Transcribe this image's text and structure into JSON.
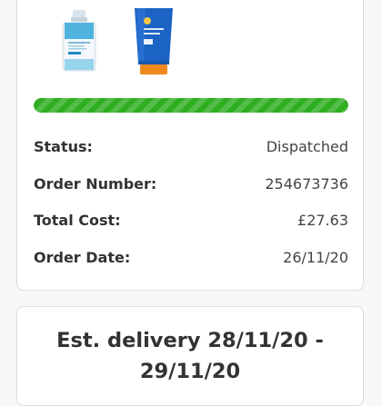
{
  "order": {
    "progress": 1.0,
    "progress_color": "#2fae21",
    "products": [
      {
        "name": "micellar-cleanser-bottle"
      },
      {
        "name": "sunscreen-tube"
      }
    ],
    "details": [
      {
        "label": "Status:",
        "value": "Dispatched"
      },
      {
        "label": "Order Number:",
        "value": "254673736"
      },
      {
        "label": "Total Cost:",
        "value": "£27.63"
      },
      {
        "label": "Order Date:",
        "value": "26/11/20"
      }
    ]
  },
  "delivery": {
    "text": "Est. delivery 28/11/20 - 29/11/20"
  }
}
